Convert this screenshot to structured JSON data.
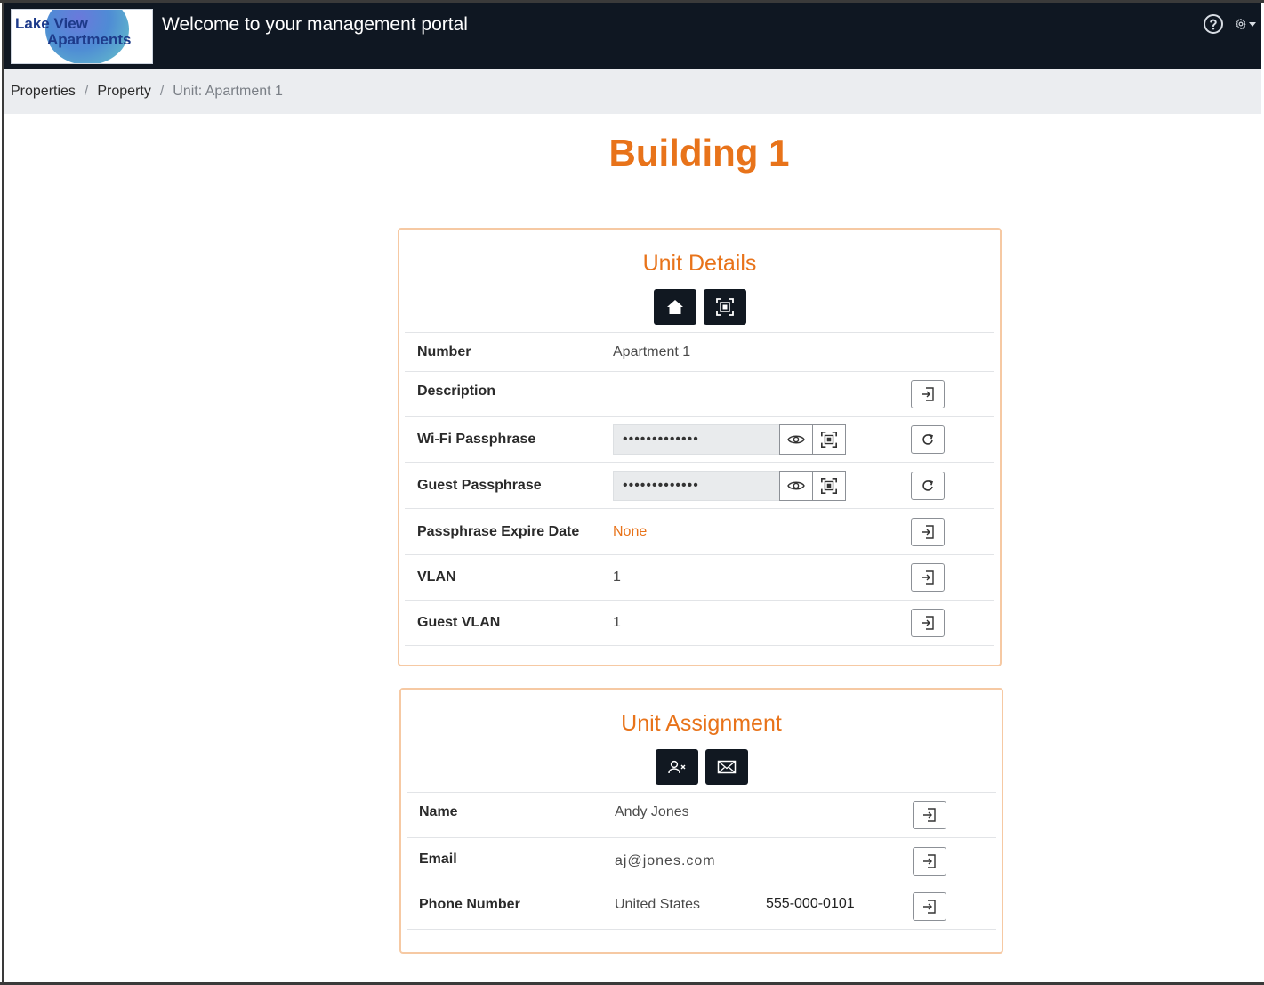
{
  "header": {
    "logo_line1": "Lake View",
    "logo_line2": "Apartments",
    "welcome": "Welcome to your management portal",
    "icons": [
      "help-icon",
      "gear-icon"
    ]
  },
  "breadcrumb": {
    "items": [
      "Properties",
      "Property"
    ],
    "current": "Unit: Apartment 1"
  },
  "page_title": "Building 1",
  "unit_details": {
    "title": "Unit Details",
    "actions": [
      "home-icon",
      "qr-code-icon"
    ],
    "rows": {
      "number": {
        "label": "Number",
        "value": "Apartment 1"
      },
      "description": {
        "label": "Description",
        "value": ""
      },
      "wifi": {
        "label": "Wi-Fi Passphrase",
        "value": "•••••••••••••"
      },
      "guest_pass": {
        "label": "Guest Passphrase",
        "value": "•••••••••••••"
      },
      "expire": {
        "label": "Passphrase Expire Date",
        "value": "None"
      },
      "vlan": {
        "label": "VLAN",
        "value": "1"
      },
      "guest_vlan": {
        "label": "Guest VLAN",
        "value": "1"
      }
    },
    "colors": {
      "accent": "#e8731a",
      "border": "#f6c9a3"
    }
  },
  "unit_assignment": {
    "title": "Unit Assignment",
    "actions": [
      "remove-user-icon",
      "mail-icon"
    ],
    "rows": {
      "name": {
        "label": "Name",
        "value": "Andy Jones"
      },
      "email": {
        "label": "Email",
        "value": "aj@jones.com"
      },
      "phone": {
        "label": "Phone Number",
        "country": "United States",
        "number": "555-000-0101"
      }
    }
  }
}
